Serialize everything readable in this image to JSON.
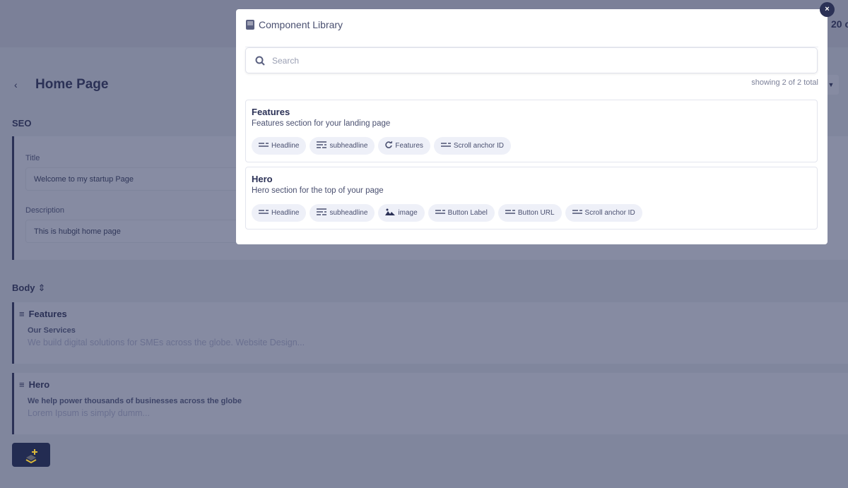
{
  "header": {
    "right_text": "20 c"
  },
  "page": {
    "back_icon": "chevron-left-icon",
    "title": "Home Page"
  },
  "seo": {
    "heading": "SEO",
    "title_label": "Title",
    "title_value": "Welcome to my startup Page",
    "description_label": "Description",
    "description_value": "This is hubgit home page"
  },
  "body": {
    "heading": "Body",
    "blocks": [
      {
        "name": "Features",
        "subtitle": "Our Services",
        "text": "We build digital solutions for SMEs across the globe. Website Design..."
      },
      {
        "name": "Hero",
        "subtitle": "We help power thousands of businesses across the globe",
        "text": "Lorem Ipsum is simply dumm..."
      }
    ]
  },
  "modal": {
    "title": "Component Library",
    "search_placeholder": "Search",
    "count": "showing 2 of 2 total",
    "components": [
      {
        "name": "Features",
        "description": "Features section for your landing page",
        "fields": [
          {
            "label": "Headline",
            "icon": "text-icon"
          },
          {
            "label": "subheadline",
            "icon": "paragraph-icon"
          },
          {
            "label": "Features",
            "icon": "repeat-icon"
          },
          {
            "label": "Scroll anchor ID",
            "icon": "text-icon"
          }
        ]
      },
      {
        "name": "Hero",
        "description": "Hero section for the top of your page",
        "fields": [
          {
            "label": "Headline",
            "icon": "text-icon"
          },
          {
            "label": "subheadline",
            "icon": "paragraph-icon"
          },
          {
            "label": "image",
            "icon": "image-icon"
          },
          {
            "label": "Button Label",
            "icon": "text-icon"
          },
          {
            "label": "Button URL",
            "icon": "text-icon"
          },
          {
            "label": "Scroll anchor ID",
            "icon": "text-icon"
          }
        ]
      }
    ]
  },
  "colors": {
    "navy": "#2b3156",
    "overlay": "#80869d",
    "chip": "#eef0f8",
    "accent": "#d9b73a"
  }
}
